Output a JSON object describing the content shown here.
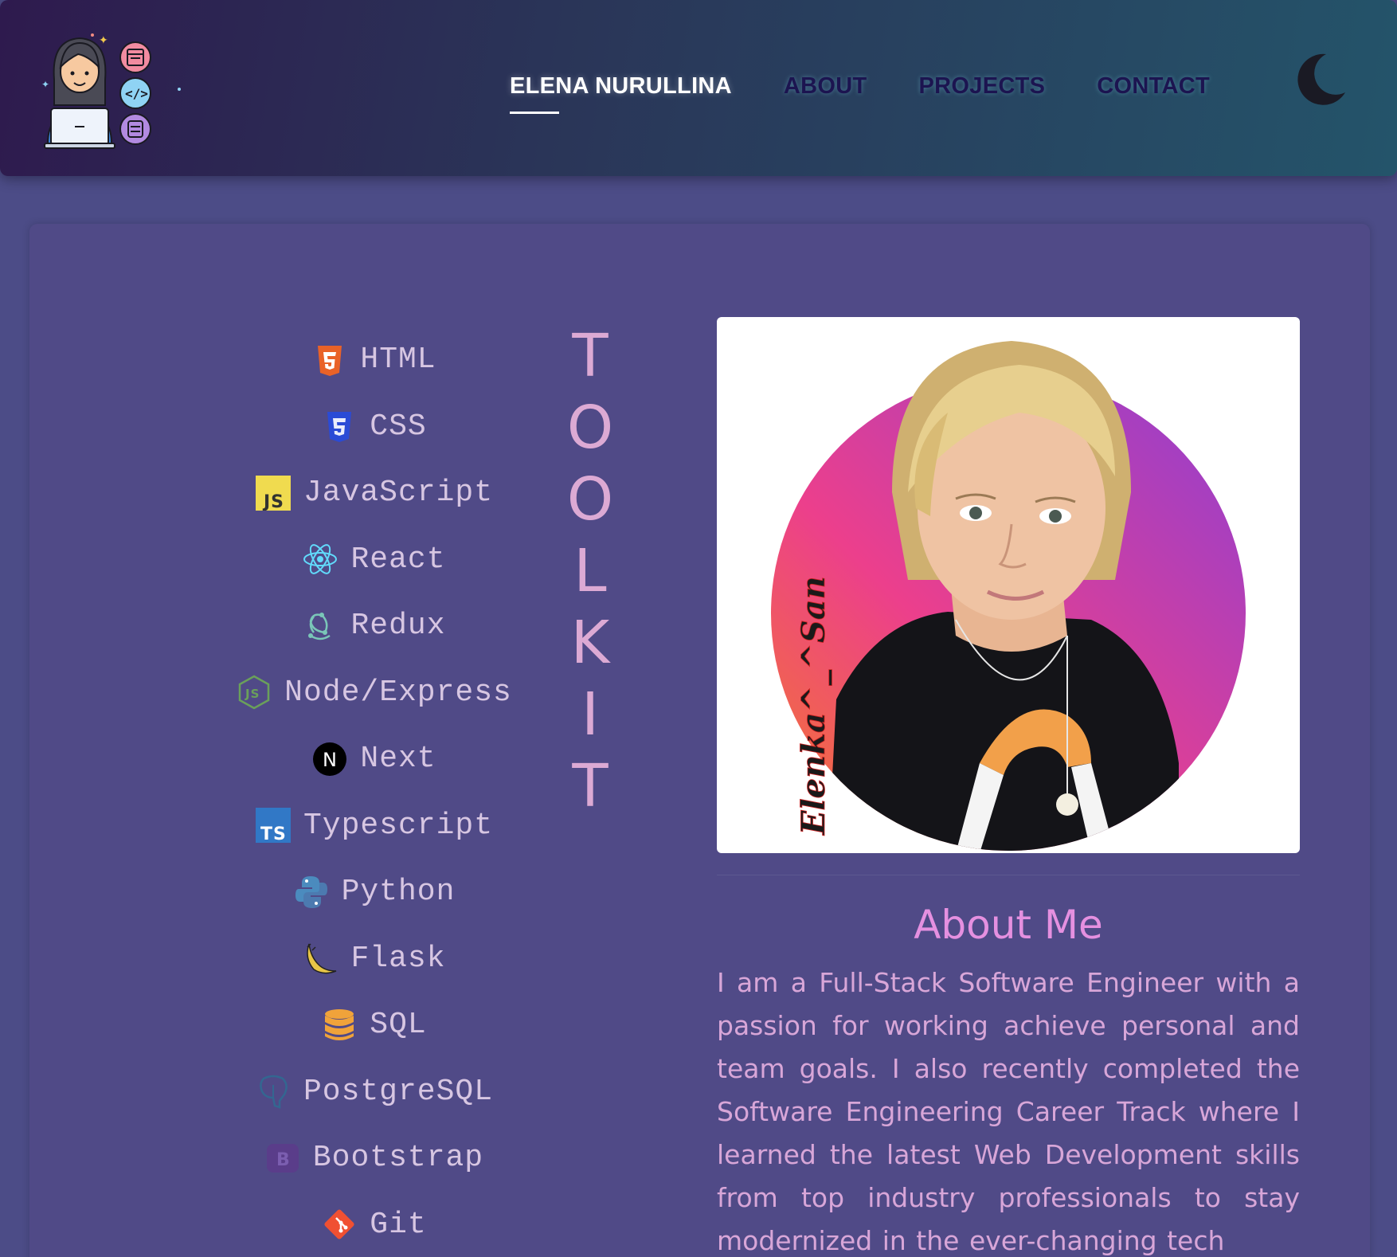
{
  "navbar": {
    "links": [
      {
        "label": "ELENA NURULLINA",
        "active": true
      },
      {
        "label": "ABOUT"
      },
      {
        "label": "PROJECTS"
      },
      {
        "label": "CONTACT"
      }
    ],
    "theme_toggle_icon": "moon-icon",
    "logo_icon": "developer-avatar-logo"
  },
  "toolkit": {
    "title_letters": [
      "T",
      "O",
      "O",
      "L",
      "K",
      "I",
      "T"
    ],
    "items": [
      {
        "label": "HTML",
        "icon": "html5-icon",
        "color": "#e96228"
      },
      {
        "label": "CSS",
        "icon": "css3-icon",
        "color": "#2a4bd6"
      },
      {
        "label": "JavaScript",
        "icon": "javascript-icon",
        "color": "#f0db4f"
      },
      {
        "label": "React",
        "icon": "react-icon",
        "color": "#61dafb"
      },
      {
        "label": "Redux",
        "icon": "redux-icon",
        "color": "#7ac6b8"
      },
      {
        "label": "Node/Express",
        "icon": "nodejs-icon",
        "color": "#6aa05a"
      },
      {
        "label": "Next",
        "icon": "nextjs-icon",
        "color": "#000000"
      },
      {
        "label": "Typescript",
        "icon": "typescript-icon",
        "color": "#3178c6"
      },
      {
        "label": "Python",
        "icon": "python-icon",
        "color": "#4b8bbe"
      },
      {
        "label": "Flask",
        "icon": "flask-icon",
        "color": "#e8c547"
      },
      {
        "label": "SQL",
        "icon": "database-icon",
        "color": "#f0a33a"
      },
      {
        "label": "PostgreSQL",
        "icon": "postgresql-icon",
        "color": "#336791"
      },
      {
        "label": "Bootstrap",
        "icon": "bootstrap-icon",
        "color": "#5a3d8a"
      },
      {
        "label": "Git",
        "icon": "git-icon",
        "color": "#f05032"
      }
    ]
  },
  "profile": {
    "signature_text": "Elenka^_^San",
    "photo_description_icon": "profile-photo"
  },
  "about": {
    "title": "About Me",
    "text": "I am a Full-Stack Software Engineer with a passion for working achieve personal and team goals. I also recently completed the Software Engineering Career Track where I learned the latest Web Development skills from top industry professionals to stay modernized in the ever-changing tech"
  },
  "colors": {
    "background": "#4c4c87",
    "card": "#504a87",
    "accent_pink": "#e590e0",
    "nav_active": "#ffffff",
    "nav_inactive": "#1c1450"
  }
}
